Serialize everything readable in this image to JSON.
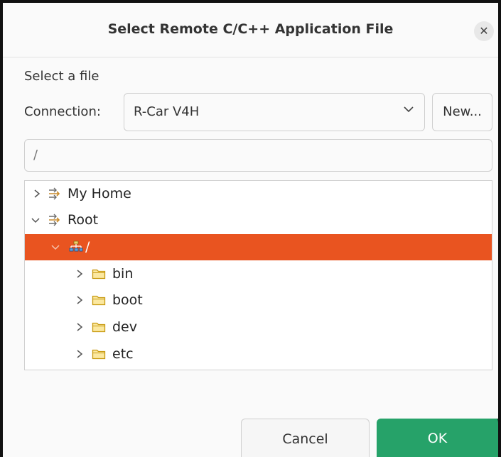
{
  "dialog": {
    "title": "Select Remote C/C++ Application File",
    "close_icon": "close-icon",
    "subtitle": "Select a file"
  },
  "connection": {
    "label": "Connection:",
    "selected": "R-Car V4H",
    "new_label": "New..."
  },
  "path": {
    "value": "/"
  },
  "tree": {
    "items": [
      {
        "label": "My Home",
        "expanded": false,
        "icon": "remote-filesystem-icon",
        "level": 0
      },
      {
        "label": "Root",
        "expanded": true,
        "icon": "remote-filesystem-icon",
        "level": 0
      },
      {
        "label": "/",
        "expanded": true,
        "icon": "root-folder-icon",
        "level": 1,
        "selected": true
      },
      {
        "label": "bin",
        "expanded": false,
        "icon": "folder-icon",
        "level": 2
      },
      {
        "label": "boot",
        "expanded": false,
        "icon": "folder-icon",
        "level": 2
      },
      {
        "label": "dev",
        "expanded": false,
        "icon": "folder-icon",
        "level": 2
      },
      {
        "label": "etc",
        "expanded": false,
        "icon": "folder-icon",
        "level": 2
      }
    ]
  },
  "buttons": {
    "cancel": "Cancel",
    "ok": "OK"
  },
  "colors": {
    "selection": "#e95420",
    "ok_button": "#26a269",
    "folder": "#f5c211"
  }
}
